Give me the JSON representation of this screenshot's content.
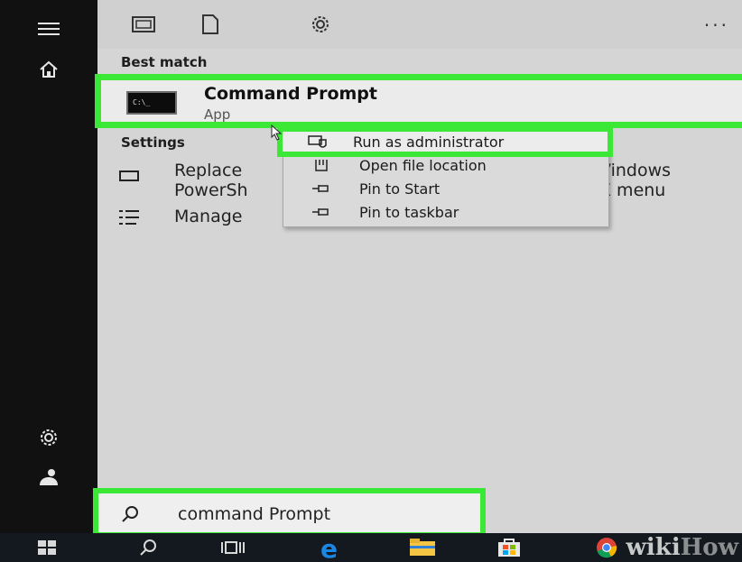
{
  "rail": {
    "items": [
      "menu-icon",
      "home-icon",
      "settings-icon",
      "user-icon"
    ]
  },
  "topbar": {
    "icons": [
      "apps-icon",
      "document-icon",
      "settings-icon"
    ],
    "more_label": "..."
  },
  "best_match": {
    "section_label": "Best match",
    "title": "Command Prompt",
    "subtitle": "App",
    "icon_text": "C:\\_"
  },
  "settings": {
    "section_label": "Settings",
    "items": [
      {
        "icon": "terminal-icon",
        "text": "Replace\nPowerSh",
        "text_right": "Vindows\nX menu"
      },
      {
        "icon": "list-icon",
        "text": "Manage"
      }
    ]
  },
  "context_menu": {
    "items": [
      {
        "icon": "admin-icon",
        "label": "Run as administrator"
      },
      {
        "icon": "folder-icon",
        "label": "Open file location"
      },
      {
        "icon": "pin-icon",
        "label": "Pin to Start"
      },
      {
        "icon": "pin-icon",
        "label": "Pin to taskbar"
      }
    ]
  },
  "search": {
    "value": "command Prompt"
  },
  "taskbar": {
    "items": [
      "windows-icon",
      "search-icon",
      "task-view-icon",
      "edge-icon",
      "file-explorer-icon",
      "store-icon",
      "chrome-icon"
    ]
  },
  "watermark": {
    "text_a": "wiki",
    "text_b": "How"
  },
  "colors": {
    "highlight": "#3be836",
    "rail": "#111111",
    "panel": "#d5d5d5",
    "taskbar": "#14191f"
  }
}
